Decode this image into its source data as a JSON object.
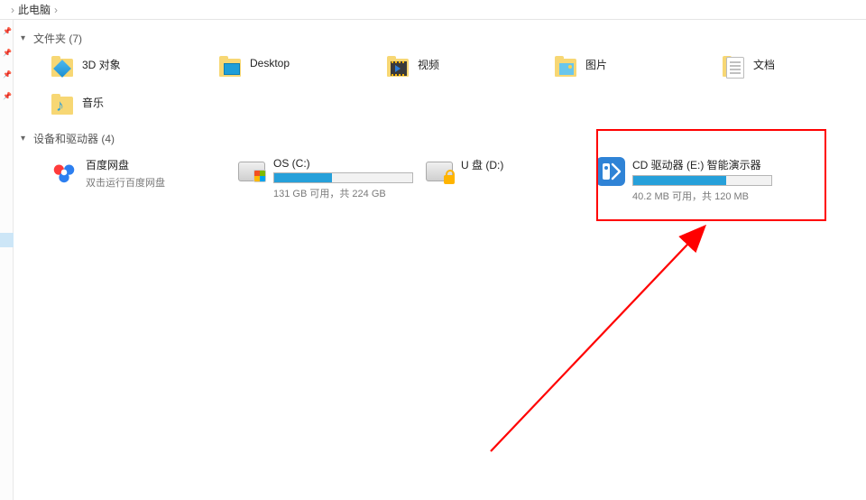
{
  "breadcrumb": {
    "root": "此电脑",
    "sep": "›"
  },
  "sections": {
    "folders": {
      "title": "文件夹 (7)"
    },
    "devices": {
      "title": "设备和驱动器 (4)"
    }
  },
  "folders": [
    {
      "name": "3D 对象"
    },
    {
      "name": "Desktop"
    },
    {
      "name": "视频"
    },
    {
      "name": "图片"
    },
    {
      "name": "文档"
    },
    {
      "name": "音乐"
    }
  ],
  "devices": {
    "baidu": {
      "name": "百度网盘",
      "sub": "双击运行百度网盘"
    },
    "osc": {
      "name": "OS (C:)",
      "sub": "131 GB 可用，共 224 GB",
      "fill_pct": 42
    },
    "usb": {
      "name": "U 盘 (D:)"
    },
    "cd": {
      "name": "CD 驱动器 (E:) 智能演示器",
      "sub": "40.2 MB 可用，共 120 MB",
      "fill_pct": 67
    }
  }
}
